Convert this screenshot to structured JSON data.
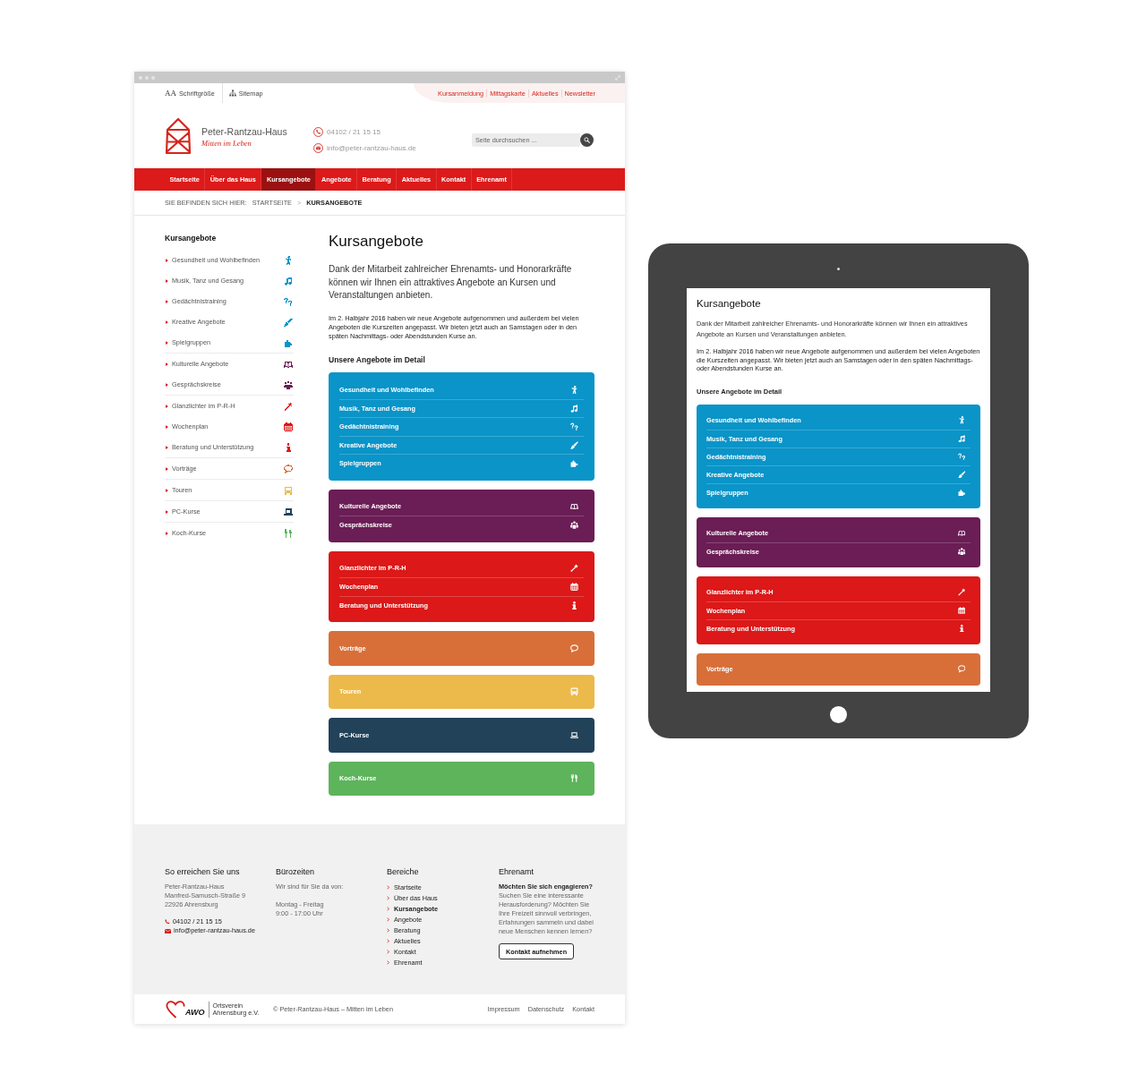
{
  "browser": {
    "top_bar": {
      "font_size": {
        "glyph": "AA",
        "label": "Schriftgröße"
      },
      "sitemap": "Sitemap",
      "quick_links": [
        "Kursanmeldung",
        "Mittagskarte",
        "Aktuelles",
        "Newsletter"
      ]
    },
    "header": {
      "site_name": "Peter-Rantzau-Haus",
      "tagline": "Mitten im Leben",
      "phone": "04102 / 21 15 15",
      "email": "info@peter-rantzau-haus.de",
      "search": {
        "placeholder": "Seite durchsuchen ..."
      }
    },
    "nav": [
      {
        "label": "Startseite",
        "selected": false
      },
      {
        "label": "Über das Haus",
        "selected": false
      },
      {
        "label": "Kursangebote",
        "selected": true
      },
      {
        "label": "Angebote",
        "selected": false
      },
      {
        "label": "Beratung",
        "selected": false
      },
      {
        "label": "Aktuelles",
        "selected": false
      },
      {
        "label": "Kontakt",
        "selected": false
      },
      {
        "label": "Ehrenamt",
        "selected": false
      }
    ],
    "breadcrumb": {
      "label": "SIE BEFINDEN SICH HIER:",
      "separator": ">",
      "items": [
        {
          "label": "STARTSEITE",
          "current": false
        },
        {
          "label": "KURSANGEBOTE",
          "current": true
        }
      ]
    },
    "sidebar": {
      "title": "Kursangebote",
      "groups": [
        {
          "color": "#0a94c8",
          "items": [
            {
              "label": "Gesundheit und Wohlbefinden",
              "kind": "figure"
            },
            {
              "label": "Musik, Tanz und Gesang",
              "kind": "music"
            },
            {
              "label": "Gedächtnistraining",
              "kind": "questions"
            },
            {
              "label": "Kreative Angebote",
              "kind": "brush"
            },
            {
              "label": "Spielgruppen",
              "kind": "puzzle"
            }
          ]
        },
        {
          "color": "#6b1d55",
          "items": [
            {
              "label": "Kulturelle Angebote",
              "kind": "book"
            },
            {
              "label": "Gesprächskreise",
              "kind": "people"
            }
          ]
        },
        {
          "color": "#dc1818",
          "items": [
            {
              "label": "Glanzlichter im P-R-H",
              "kind": "wand"
            },
            {
              "label": "Wochenplan",
              "kind": "calendar"
            },
            {
              "label": "Beratung und Unterstützung",
              "kind": "info"
            }
          ]
        },
        {
          "color": "#d86f39",
          "items": [
            {
              "label": "Vorträge",
              "kind": "speech"
            }
          ]
        },
        {
          "color": "#ecb94b",
          "items": [
            {
              "label": "Touren",
              "kind": "bus"
            }
          ]
        },
        {
          "color": "#22425a",
          "items": [
            {
              "label": "PC-Kurse",
              "kind": "laptop"
            }
          ]
        },
        {
          "color": "#5db45b",
          "items": [
            {
              "label": "Koch-Kurse",
              "kind": "cutlery"
            }
          ]
        }
      ]
    },
    "content": {
      "title": "Kursangebote",
      "lead": "Dank der Mitarbeit zahlreicher Ehrenamts- und Honorarkräfte können wir Ihnen ein attraktives Angebote an Kursen und Veranstaltungen anbieten.",
      "text": "Im 2. Halbjahr 2016 haben wir neue Angebote aufgenommen und außerdem bei vielen Angeboten die Kurszeiten angepasst. Wir bieten jetzt auch an Samstagen oder in den späten Nachmittags- oder Abendstunden Kurse an.",
      "subtitle": "Unsere Angebote im Detail",
      "groups": [
        {
          "color": "#0a94c8",
          "items": [
            {
              "label": "Gesundheit und Wohlbefinden",
              "kind": "figure"
            },
            {
              "label": "Musik, Tanz und Gesang",
              "kind": "music"
            },
            {
              "label": "Gedächtnistraining",
              "kind": "questions"
            },
            {
              "label": "Kreative Angebote",
              "kind": "brush"
            },
            {
              "label": "Spielgruppen",
              "kind": "puzzle"
            }
          ]
        },
        {
          "color": "#6b1d55",
          "items": [
            {
              "label": "Kulturelle Angebote",
              "kind": "book"
            },
            {
              "label": "Gesprächskreise",
              "kind": "people"
            }
          ]
        },
        {
          "color": "#dc1818",
          "items": [
            {
              "label": "Glanzlichter im P-R-H",
              "kind": "wand"
            },
            {
              "label": "Wochenplan",
              "kind": "calendar"
            },
            {
              "label": "Beratung und Unterstützung",
              "kind": "info"
            }
          ]
        },
        {
          "color": "#d86f39",
          "items": [
            {
              "label": "Vorträge",
              "kind": "speech"
            }
          ]
        },
        {
          "color": "#ecb94b",
          "items": [
            {
              "label": "Touren",
              "kind": "bus"
            }
          ]
        },
        {
          "color": "#22425a",
          "items": [
            {
              "label": "PC-Kurse",
              "kind": "laptop"
            }
          ]
        },
        {
          "color": "#5db45b",
          "items": [
            {
              "label": "Koch-Kurse",
              "kind": "cutlery"
            }
          ]
        }
      ]
    },
    "footer": {
      "contact": {
        "title": "So erreichen Sie uns",
        "address": [
          "Peter-Rantzau-Haus",
          "Manfred-Samusch-Straße 9",
          "22926 Ahrensburg"
        ],
        "phone": "04102 / 21 15 15",
        "email": "info@peter-rantzau-haus.de"
      },
      "office_hours": {
        "title": "Bürozeiten",
        "intro": "Wir sind für Sie da von:",
        "days": "Montag - Freitag",
        "hours": "9:00 - 17:00 Uhr"
      },
      "areas": {
        "title": "Bereiche",
        "links": [
          {
            "label": "Startseite",
            "selected": false
          },
          {
            "label": "Über das Haus",
            "selected": false
          },
          {
            "label": "Kursangebote",
            "selected": true
          },
          {
            "label": "Angebote",
            "selected": false
          },
          {
            "label": "Beratung",
            "selected": false
          },
          {
            "label": "Aktuelles",
            "selected": false
          },
          {
            "label": "Kontakt",
            "selected": false
          },
          {
            "label": "Ehrenamt",
            "selected": false
          }
        ]
      },
      "volunteering": {
        "title": "Ehrenamt",
        "question": "Möchten Sie sich engagieren?",
        "text": "Suchen Sie eine interessante Herausforderung? Möchten Sie Ihre Freizeit sinnvoll verbringen, Erfahrungen sammeln und dabei neue Menschen kennen lernen?",
        "button": "Kontakt aufnehmen"
      }
    },
    "bottom_bar": {
      "logo": {
        "mark": "AWO",
        "lines": [
          "Ortsverein",
          "Ahrensburg e.V."
        ]
      },
      "copyright": "© Peter-Rantzau-Haus – Mitten im Leben",
      "links": [
        "Impressum",
        "Datenschutz",
        "Kontakt"
      ]
    }
  },
  "tablet": {
    "title": "Kursangebote",
    "lead": "Dank der Mitarbeit zahlreicher Ehrenamts- und Honorarkräfte können wir Ihnen ein attraktives Angebote an Kursen und Veranstaltungen anbieten.",
    "text": "Im 2. Halbjahr 2016 haben wir neue Angebote aufgenommen und außerdem bei vielen Angeboten die Kurszeiten angepasst. Wir bieten jetzt auch an Samstagen oder in den späten Nachmittags- oder Abendstunden Kurse an.",
    "subtitle": "Unsere Angebote im Detail",
    "groups": [
      {
        "color": "#0a94c8",
        "items": [
          {
            "label": "Gesundheit und Wohlbefinden",
            "kind": "figure"
          },
          {
            "label": "Musik, Tanz und Gesang",
            "kind": "music"
          },
          {
            "label": "Gedächtnistraining",
            "kind": "questions"
          },
          {
            "label": "Kreative Angebote",
            "kind": "brush"
          },
          {
            "label": "Spielgruppen",
            "kind": "puzzle"
          }
        ]
      },
      {
        "color": "#6b1d55",
        "items": [
          {
            "label": "Kulturelle Angebote",
            "kind": "book"
          },
          {
            "label": "Gesprächskreise",
            "kind": "people"
          }
        ]
      },
      {
        "color": "#dc1818",
        "items": [
          {
            "label": "Glanzlichter im P-R-H",
            "kind": "wand"
          },
          {
            "label": "Wochenplan",
            "kind": "calendar"
          },
          {
            "label": "Beratung und Unterstützung",
            "kind": "info"
          }
        ]
      },
      {
        "color": "#d86f39",
        "items": [
          {
            "label": "Vorträge",
            "kind": "speech"
          }
        ]
      }
    ]
  }
}
